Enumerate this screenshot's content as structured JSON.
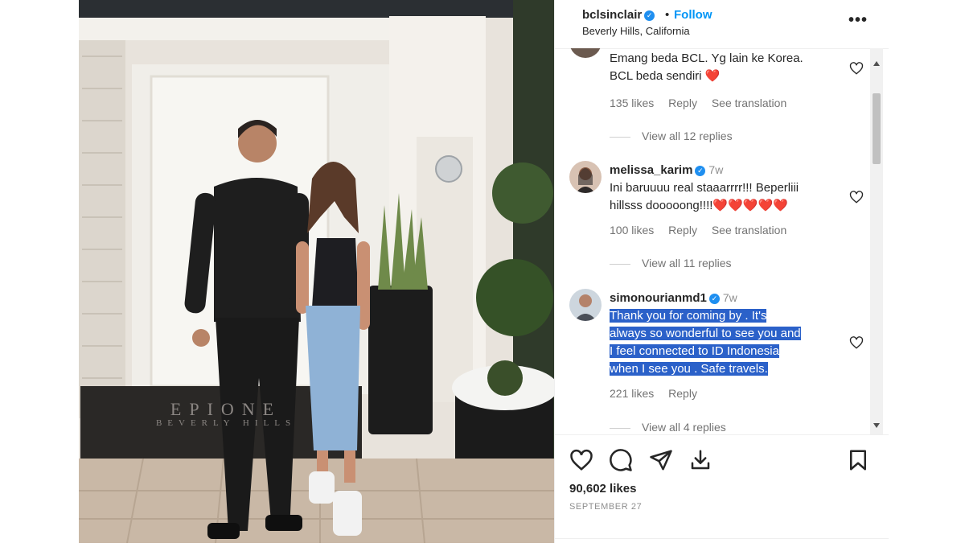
{
  "header": {
    "username": "bclsinclair",
    "separator": "•",
    "follow_label": "Follow",
    "location": "Beverly Hills, California",
    "more_label": "•••"
  },
  "photo": {
    "doormat_text": "EPIONE",
    "doormat_subtext": "BEVERLY HILLS"
  },
  "comments": [
    {
      "username": "",
      "time": "",
      "lines": [
        "Emang beda BCL. Yg lain ke Korea.",
        "BCL beda sendiri ❤️"
      ],
      "likes": "135 likes",
      "reply": "Reply",
      "translation": "See translation",
      "view_replies": "View all 12 replies"
    },
    {
      "username": "melissa_karim",
      "time": "7w",
      "lines": [
        "Ini baruuuu real staaarrrr!!! Beperliii",
        "hillsss dooooong!!!!❤️❤️❤️❤️❤️"
      ],
      "likes": "100 likes",
      "reply": "Reply",
      "translation": "See translation",
      "view_replies": "View all 11 replies"
    },
    {
      "username": "simonourianmd1",
      "time": "7w",
      "lines": [
        "Thank you for coming by . It's",
        "always so wonderful to see you and",
        "I feel connected to ID Indonesia",
        "when I see you . Safe travels."
      ],
      "likes": "221 likes",
      "reply": "Reply",
      "view_replies": "View all 4 replies"
    }
  ],
  "footer": {
    "likes": "90,602 likes",
    "date": "SEPTEMBER 27"
  },
  "colors": {
    "accent": "#0095f6",
    "verified": "#1f8ff0",
    "heart": "#ed1c24",
    "selection": "#2b61c9"
  }
}
